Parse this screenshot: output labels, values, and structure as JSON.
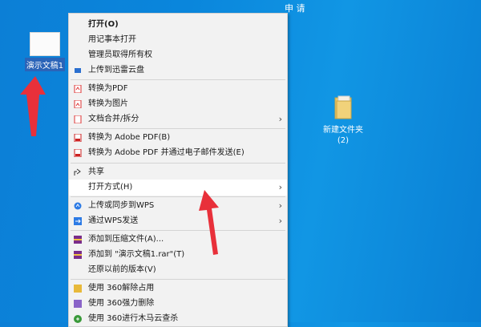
{
  "top_text": "申 请",
  "desktop": {
    "doc_label": "演示文稿1",
    "folder_label_line1": "新建文件夹",
    "folder_label_line2": "(2)"
  },
  "menu": {
    "items": [
      {
        "label": "打开(O)",
        "bold": true
      },
      {
        "label": "用记事本打开"
      },
      {
        "label": "管理员取得所有权"
      },
      {
        "label": "上传到迅雷云盘"
      },
      {
        "label": "转换为PDF"
      },
      {
        "label": "转换为图片"
      },
      {
        "label": "文档合并/拆分"
      },
      {
        "label": "转换为 Adobe PDF(B)"
      },
      {
        "label": "转换为 Adobe PDF 并通过电子邮件发送(E)"
      },
      {
        "label": "共享"
      },
      {
        "label": "打开方式(H)"
      },
      {
        "label": "上传或同步到WPS"
      },
      {
        "label": "通过WPS发送"
      },
      {
        "label": "添加到压缩文件(A)..."
      },
      {
        "label": "添加到 \"演示文稿1.rar\"(T)"
      },
      {
        "label": "还原以前的版本(V)"
      },
      {
        "label": "使用 360解除占用"
      },
      {
        "label": "使用 360强力删除"
      },
      {
        "label": "使用 360进行木马云查杀"
      }
    ]
  },
  "colors": {
    "arrow": "#e8303a",
    "highlight": "#ffffff",
    "menu_bg": "#f2f2f2"
  }
}
